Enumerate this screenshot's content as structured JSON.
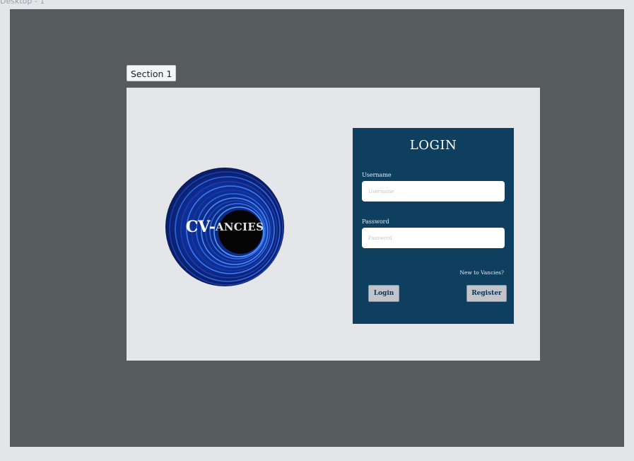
{
  "canvas": {
    "frame_label": "Desktop - 1"
  },
  "section": {
    "tag_label": "Section 1"
  },
  "logo": {
    "text_big": "CV-",
    "text_small": "ANCIES"
  },
  "login": {
    "title": "LOGIN",
    "username": {
      "label": "Username",
      "placeholder": "Username",
      "value": ""
    },
    "password": {
      "label": "Password",
      "placeholder": "Password",
      "value": ""
    },
    "new_prompt": "New to Vancies?",
    "login_button": "Login",
    "register_button": "Register"
  },
  "colors": {
    "page_bg": "#e3e5e8",
    "frame_bg": "#565c5e",
    "section_bg": "#e4e6ea",
    "card_bg": "#0e3f5f",
    "button_bg": "#c1c4c9",
    "logo_blue": "#1f5fd6"
  }
}
